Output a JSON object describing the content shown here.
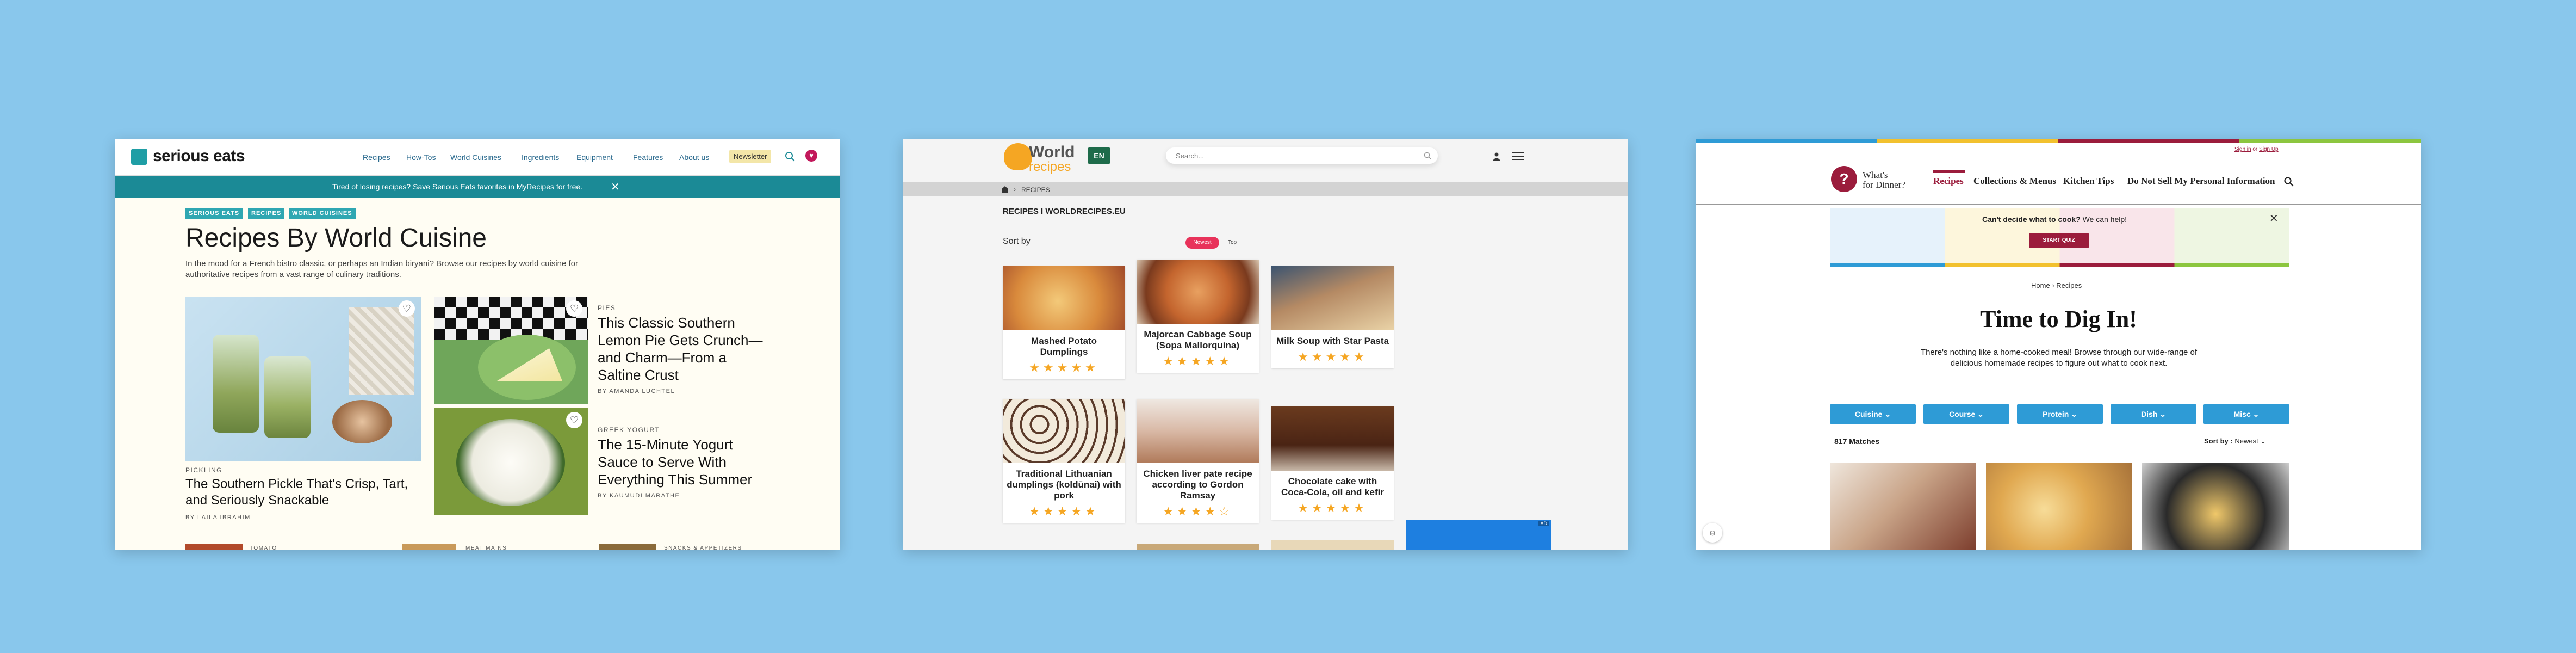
{
  "serious_eats": {
    "logo": "serious eats",
    "nav": [
      "Recipes",
      "How-Tos",
      "World Cuisines",
      "Ingredients",
      "Equipment",
      "Features",
      "About us"
    ],
    "newsletter": "Newsletter",
    "banner": "Tired of losing recipes? Save Serious Eats favorites in MyRecipes for free.",
    "tags": [
      "SERIOUS EATS",
      "RECIPES",
      "WORLD CUISINES"
    ],
    "title": "Recipes By World Cuisine",
    "intro": "In the mood for a French bistro classic, or perhaps an Indian biryani? Browse our recipes by world cuisine for authoritative recipes from a vast range of culinary traditions.",
    "feature": {
      "kicker": "PICKLING",
      "title": "The Southern Pickle That's Crisp, Tart, and Seriously Snackable",
      "byline": "BY LAILA IBRAHIM"
    },
    "articles": [
      {
        "kicker": "PIES",
        "title": "This Classic Southern Lemon Pie Gets Crunch—and Charm—From a Saltine Crust",
        "byline": "BY AMANDA LUCHTEL"
      },
      {
        "kicker": "GREEK YOGURT",
        "title": "The 15-Minute Yogurt Sauce to Serve With Everything This Summer",
        "byline": "BY KAUMUDI MARATHE"
      }
    ],
    "bottom_kickers": [
      "TOMATO",
      "MEAT MAINS",
      "SNACKS & APPETIZERS"
    ]
  },
  "world_recipes": {
    "logo_top": "World",
    "logo_bottom": "recipes",
    "lang": "EN",
    "search_placeholder": "Search...",
    "breadcrumb": "RECIPES",
    "heading": "RECIPES I WORLDRECIPES.EU",
    "sort_label": "Sort by",
    "sort_options": [
      "Newest",
      "Top"
    ],
    "recipes": [
      {
        "name": "Mashed Potato Dumplings",
        "stars": "★★★★★"
      },
      {
        "name": "Majorcan Cabbage Soup (Sopa Mallorquina)",
        "stars": "★★★★★"
      },
      {
        "name": "Milk Soup with Star Pasta",
        "stars": "★★★★★"
      },
      {
        "name": "Traditional Lithuanian dumplings (koldūnai) with pork",
        "stars": "★★★★★"
      },
      {
        "name": "Chicken liver pate recipe according to Gordon Ramsay",
        "stars": "★★★★☆"
      },
      {
        "name": "Chocolate cake with Coca-Cola, oil and kefir",
        "stars": "★★★★★"
      }
    ],
    "ad_label": "AD"
  },
  "whats_for_dinner": {
    "signin": "Sign in",
    "or": "or",
    "signup": "Sign Up",
    "logo_line1": "What's",
    "logo_line2": "for Dinner?",
    "nav": [
      "Recipes",
      "Collections & Menus",
      "Kitchen Tips",
      "Do Not Sell My Personal Information"
    ],
    "quiz_text": "Can't decide what to cook?",
    "quiz_help": "We can help!",
    "quiz_button": "START QUIZ",
    "breadcrumb": [
      "Home",
      "Recipes"
    ],
    "title": "Time to Dig In!",
    "intro": "There's nothing like a home-cooked meal! Browse through our wide-range of delicious homemade recipes to figure out what to cook next.",
    "filters": [
      "Cuisine",
      "Course",
      "Protein",
      "Dish",
      "Misc"
    ],
    "matches": "817 Matches",
    "sort_label": "Sort by :",
    "sort_value": "Newest"
  },
  "colors": {
    "background": "#89c7ec",
    "se_teal": "#1b8a96",
    "wr_orange": "#f5a623",
    "wr_green": "#1e6b4a",
    "wfd_blue": "#2e9bd6",
    "wfd_red": "#9b1c3c"
  }
}
